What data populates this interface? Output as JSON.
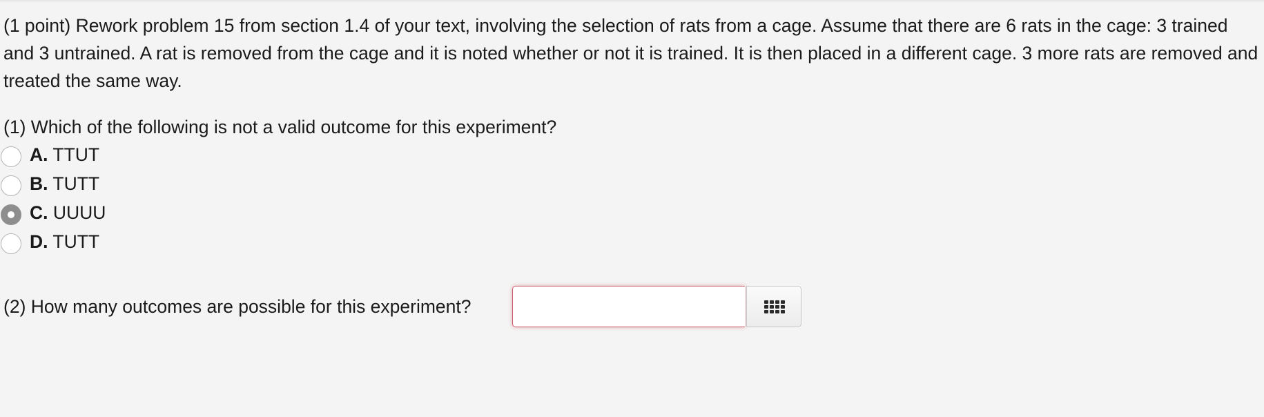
{
  "problem": {
    "intro": "(1 point) Rework problem 15 from section 1.4 of your text, involving the selection of rats from a cage. Assume that there are 6 rats in the cage: 3 trained and 3 untrained. A rat is removed from the cage and it is noted whether or not it is trained. It is then placed in a different cage. 3 more rats are removed and treated the same way."
  },
  "question1": {
    "prompt": "(1) Which of the following is not a valid outcome for this experiment?",
    "selected": "C",
    "choices": [
      {
        "letter": "A.",
        "text": "TTUT",
        "checked": false
      },
      {
        "letter": "B.",
        "text": "TUTT",
        "checked": false
      },
      {
        "letter": "C.",
        "text": "UUUU",
        "checked": true
      },
      {
        "letter": "D.",
        "text": "TUTT",
        "checked": false
      }
    ]
  },
  "question2": {
    "prompt": "(2) How many outcomes are possible for this experiment?",
    "answer_value": "",
    "palette_icon": "grid-icon"
  },
  "colors": {
    "background": "#f4f4f4",
    "input_error_border": "#cf5d66",
    "radio_checked": "#8e8e8e"
  }
}
